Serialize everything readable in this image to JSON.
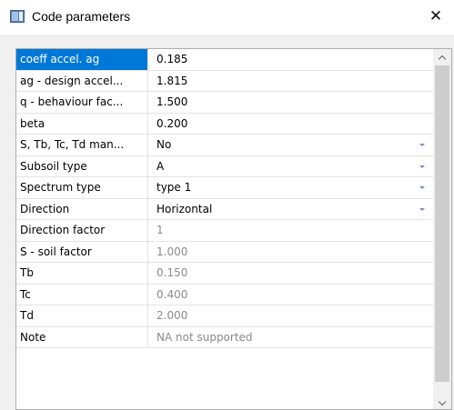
{
  "window": {
    "title": "Code parameters",
    "close_glyph": "✕"
  },
  "rows": [
    {
      "name": "coeff accel. ag",
      "value": "0.185",
      "dropdown": false,
      "readonly": false,
      "selected": true
    },
    {
      "name": "ag - design accel...",
      "value": "1.815",
      "dropdown": false,
      "readonly": false,
      "selected": false
    },
    {
      "name": "q - behaviour fac...",
      "value": "1.500",
      "dropdown": false,
      "readonly": false,
      "selected": false
    },
    {
      "name": "beta",
      "value": "0.200",
      "dropdown": false,
      "readonly": false,
      "selected": false
    },
    {
      "name": "S, Tb, Tc, Td man...",
      "value": "No",
      "dropdown": true,
      "readonly": false,
      "selected": false
    },
    {
      "name": "Subsoil type",
      "value": "A",
      "dropdown": true,
      "readonly": false,
      "selected": false
    },
    {
      "name": "Spectrum type",
      "value": "type 1",
      "dropdown": true,
      "readonly": false,
      "selected": false
    },
    {
      "name": "Direction",
      "value": "Horizontal",
      "dropdown": true,
      "readonly": false,
      "selected": false
    },
    {
      "name": "Direction factor",
      "value": "1",
      "dropdown": false,
      "readonly": true,
      "selected": false
    },
    {
      "name": "S - soil factor",
      "value": "1.000",
      "dropdown": false,
      "readonly": true,
      "selected": false
    },
    {
      "name": "Tb",
      "value": "0.150",
      "dropdown": false,
      "readonly": true,
      "selected": false
    },
    {
      "name": "Tc",
      "value": "0.400",
      "dropdown": false,
      "readonly": true,
      "selected": false
    },
    {
      "name": "Td",
      "value": "2.000",
      "dropdown": false,
      "readonly": true,
      "selected": false
    },
    {
      "name": "Note",
      "value": "NA not supported",
      "dropdown": false,
      "readonly": true,
      "selected": false
    }
  ],
  "colors": {
    "selected_bg": "#0078d7",
    "readonly_text": "#8a8a8a",
    "dropdown_arrow": "#6b8fc7"
  },
  "icons": {
    "app": "window-icon",
    "close": "close-icon",
    "dropdown": "chevron-down-icon",
    "scroll_up": "chevron-up-icon",
    "scroll_down": "chevron-down-icon"
  }
}
